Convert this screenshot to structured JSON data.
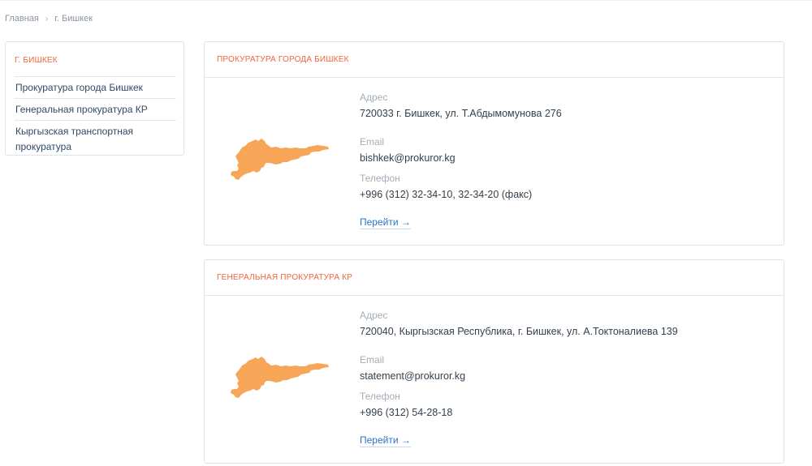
{
  "breadcrumb": {
    "home": "Главная",
    "current": "г. Бишкек"
  },
  "sidebar": {
    "title": "Г. БИШКЕК",
    "items": [
      {
        "label": "Прокуратура города Бишкек"
      },
      {
        "label": "Генеральная прокуратура КР"
      },
      {
        "label": "Кыргызская транспортная прокуратура"
      }
    ]
  },
  "colors": {
    "accent": "#f0643c",
    "link": "#2a72c4",
    "map_fill": "#f7a657"
  },
  "cards": [
    {
      "title": "ПРОКУРАТУРА ГОРОДА БИШКЕК",
      "address_label": "Адрес",
      "address": "720033  г. Бишкек,  ул. Т.Абдымомунова 276",
      "email_label": "Email",
      "email": "bishkek@prokuror.kg",
      "phone_label": "Телефон",
      "phone": "+996 (312) 32-34-10, 32-34-20 (факс)",
      "link_label": "Перейти →",
      "map_icon": "kyrgyzstan-map-icon"
    },
    {
      "title": "ГЕНЕРАЛЬНАЯ ПРОКУРАТУРА КР",
      "address_label": "Адрес",
      "address": "720040, Кыргызская Республика, г. Бишкек, ул. А.Токтоналиева 139",
      "email_label": "Email",
      "email": "statement@prokuror.kg",
      "phone_label": "Телефон",
      "phone": "+996 (312) 54-28-18",
      "link_label": "Перейти →",
      "map_icon": "kyrgyzstan-map-icon"
    }
  ]
}
